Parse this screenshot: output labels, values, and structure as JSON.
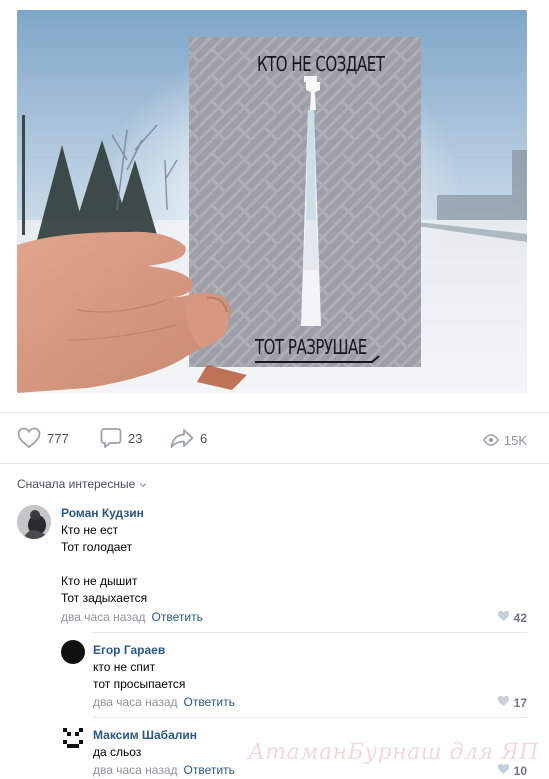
{
  "post": {
    "card_top_text": "КТО НЕ СОЗДАЕТ",
    "card_bottom_text": "ТОТ РАЗРУШАЕ"
  },
  "actions": {
    "likes": "777",
    "comments": "23",
    "shares": "6",
    "views": "15K"
  },
  "comments_header": {
    "sort_label": "Сначала интересные"
  },
  "comments": [
    {
      "author": "Роман Кудзин",
      "text": "Кто не ест\nТот голодает\n\nКто не дышит\nТот задыхается",
      "time": "два часа назад",
      "reply_label": "Ответить",
      "likes": "42"
    },
    {
      "author": "Егор Гараев",
      "text": "кто не спит\nтот просыпается",
      "time": "два часа назад",
      "reply_label": "Ответить",
      "likes": "17"
    },
    {
      "author": "Максим Шабалин",
      "text": "да сльоз",
      "time": "два часа назад",
      "reply_label": "Ответить",
      "likes": "10"
    }
  ],
  "watermark": "АтаманБурнаш для ЯП",
  "colors": {
    "link": "#2a5885",
    "meta": "#909399",
    "icon": "#99a2ad"
  }
}
